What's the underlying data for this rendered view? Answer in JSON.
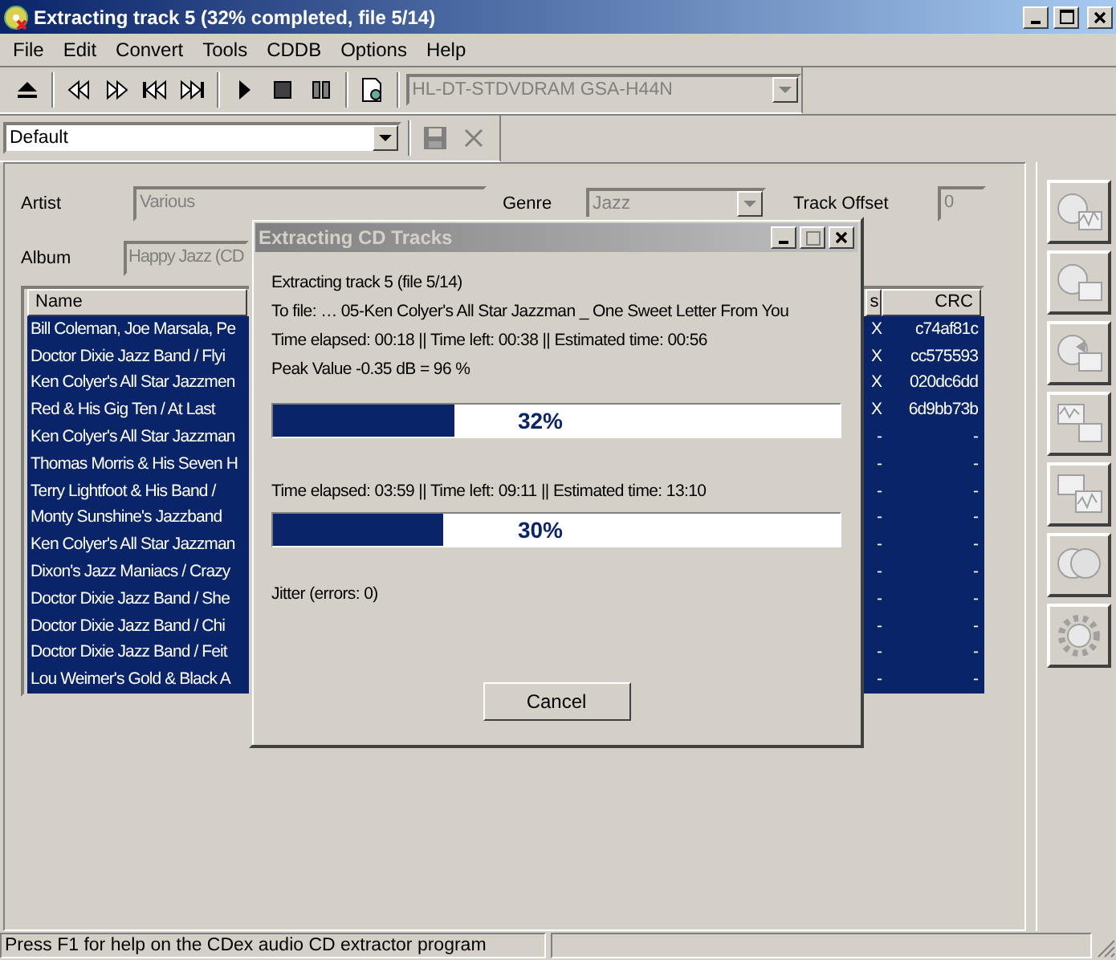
{
  "window": {
    "title": "Extracting track 5 (32% completed, file 5/14)"
  },
  "menu": [
    "File",
    "Edit",
    "Convert",
    "Tools",
    "CDDB",
    "Options",
    "Help"
  ],
  "toolbar": {
    "drive": "HL-DT-STDVDRAM GSA-H44N"
  },
  "profile": {
    "value": "Default"
  },
  "artist": {
    "label": "Artist",
    "value": "Various"
  },
  "genre": {
    "label": "Genre",
    "value": "Jazz"
  },
  "track_offset": {
    "label": "Track Offset",
    "value": "0"
  },
  "album": {
    "label": "Album",
    "value": "Happy Jazz (CD"
  },
  "table": {
    "columns": [
      "Name",
      "s",
      "CRC"
    ],
    "rows": [
      {
        "name": "Bill Coleman, Joe Marsala, Pe",
        "status": "X",
        "crc": "c74af81c",
        "selected": true
      },
      {
        "name": "Doctor Dixie Jazz Band / Flyi",
        "status": "X",
        "crc": "cc575593",
        "selected": true
      },
      {
        "name": "Ken Colyer's All Star Jazzmen",
        "status": "X",
        "crc": "020dc6dd",
        "selected": true
      },
      {
        "name": "Red & His Gig Ten / At Last",
        "status": "X",
        "crc": "6d9bb73b",
        "selected": true
      },
      {
        "name": "Ken Colyer's All Star Jazzman",
        "status": "-",
        "crc": "-",
        "selected": true
      },
      {
        "name": "Thomas Morris & His Seven H",
        "status": "-",
        "crc": "-",
        "selected": true
      },
      {
        "name": "Terry Lightfoot & His Band /",
        "status": "-",
        "crc": "-",
        "selected": true
      },
      {
        "name": "Monty Sunshine's Jazzband",
        "status": "-",
        "crc": "-",
        "selected": true
      },
      {
        "name": "Ken Colyer's All Star Jazzman",
        "status": "-",
        "crc": "-",
        "selected": true
      },
      {
        "name": "Dixon's Jazz Maniacs / Crazy",
        "status": "-",
        "crc": "-",
        "selected": true
      },
      {
        "name": "Doctor Dixie Jazz Band / She",
        "status": "-",
        "crc": "-",
        "selected": true
      },
      {
        "name": "Doctor Dixie Jazz Band / Chi",
        "status": "-",
        "crc": "-",
        "selected": true
      },
      {
        "name": "Doctor Dixie Jazz Band / Feit",
        "status": "-",
        "crc": "-",
        "selected": true
      },
      {
        "name": "Lou Weimer's Gold & Black A",
        "status": "-",
        "crc": "-",
        "selected": true
      }
    ]
  },
  "dialog": {
    "title": "Extracting CD Tracks",
    "track_line": "Extracting track 5 (file 5/14)",
    "file_line": "To file:  … 05-Ken Colyer's All Star Jazzman _ One Sweet Letter From You",
    "time_line": "Time elapsed: 00:18 || Time left: 00:38 || Estimated time: 00:56",
    "peak_line": "Peak Value -0.35 dB =  96 %",
    "track_progress": {
      "level": 0.32,
      "label": "32%"
    },
    "total_time_line": "Time elapsed: 03:59 || Time left: 09:11 || Estimated time: 13:10",
    "total_progress": {
      "level": 0.3,
      "label": "30%"
    },
    "jitter_line": "Jitter (errors: 0)",
    "cancel_button": "Cancel"
  },
  "status_bar": {
    "text": "Press F1 for help on the CDex audio CD extractor program"
  }
}
